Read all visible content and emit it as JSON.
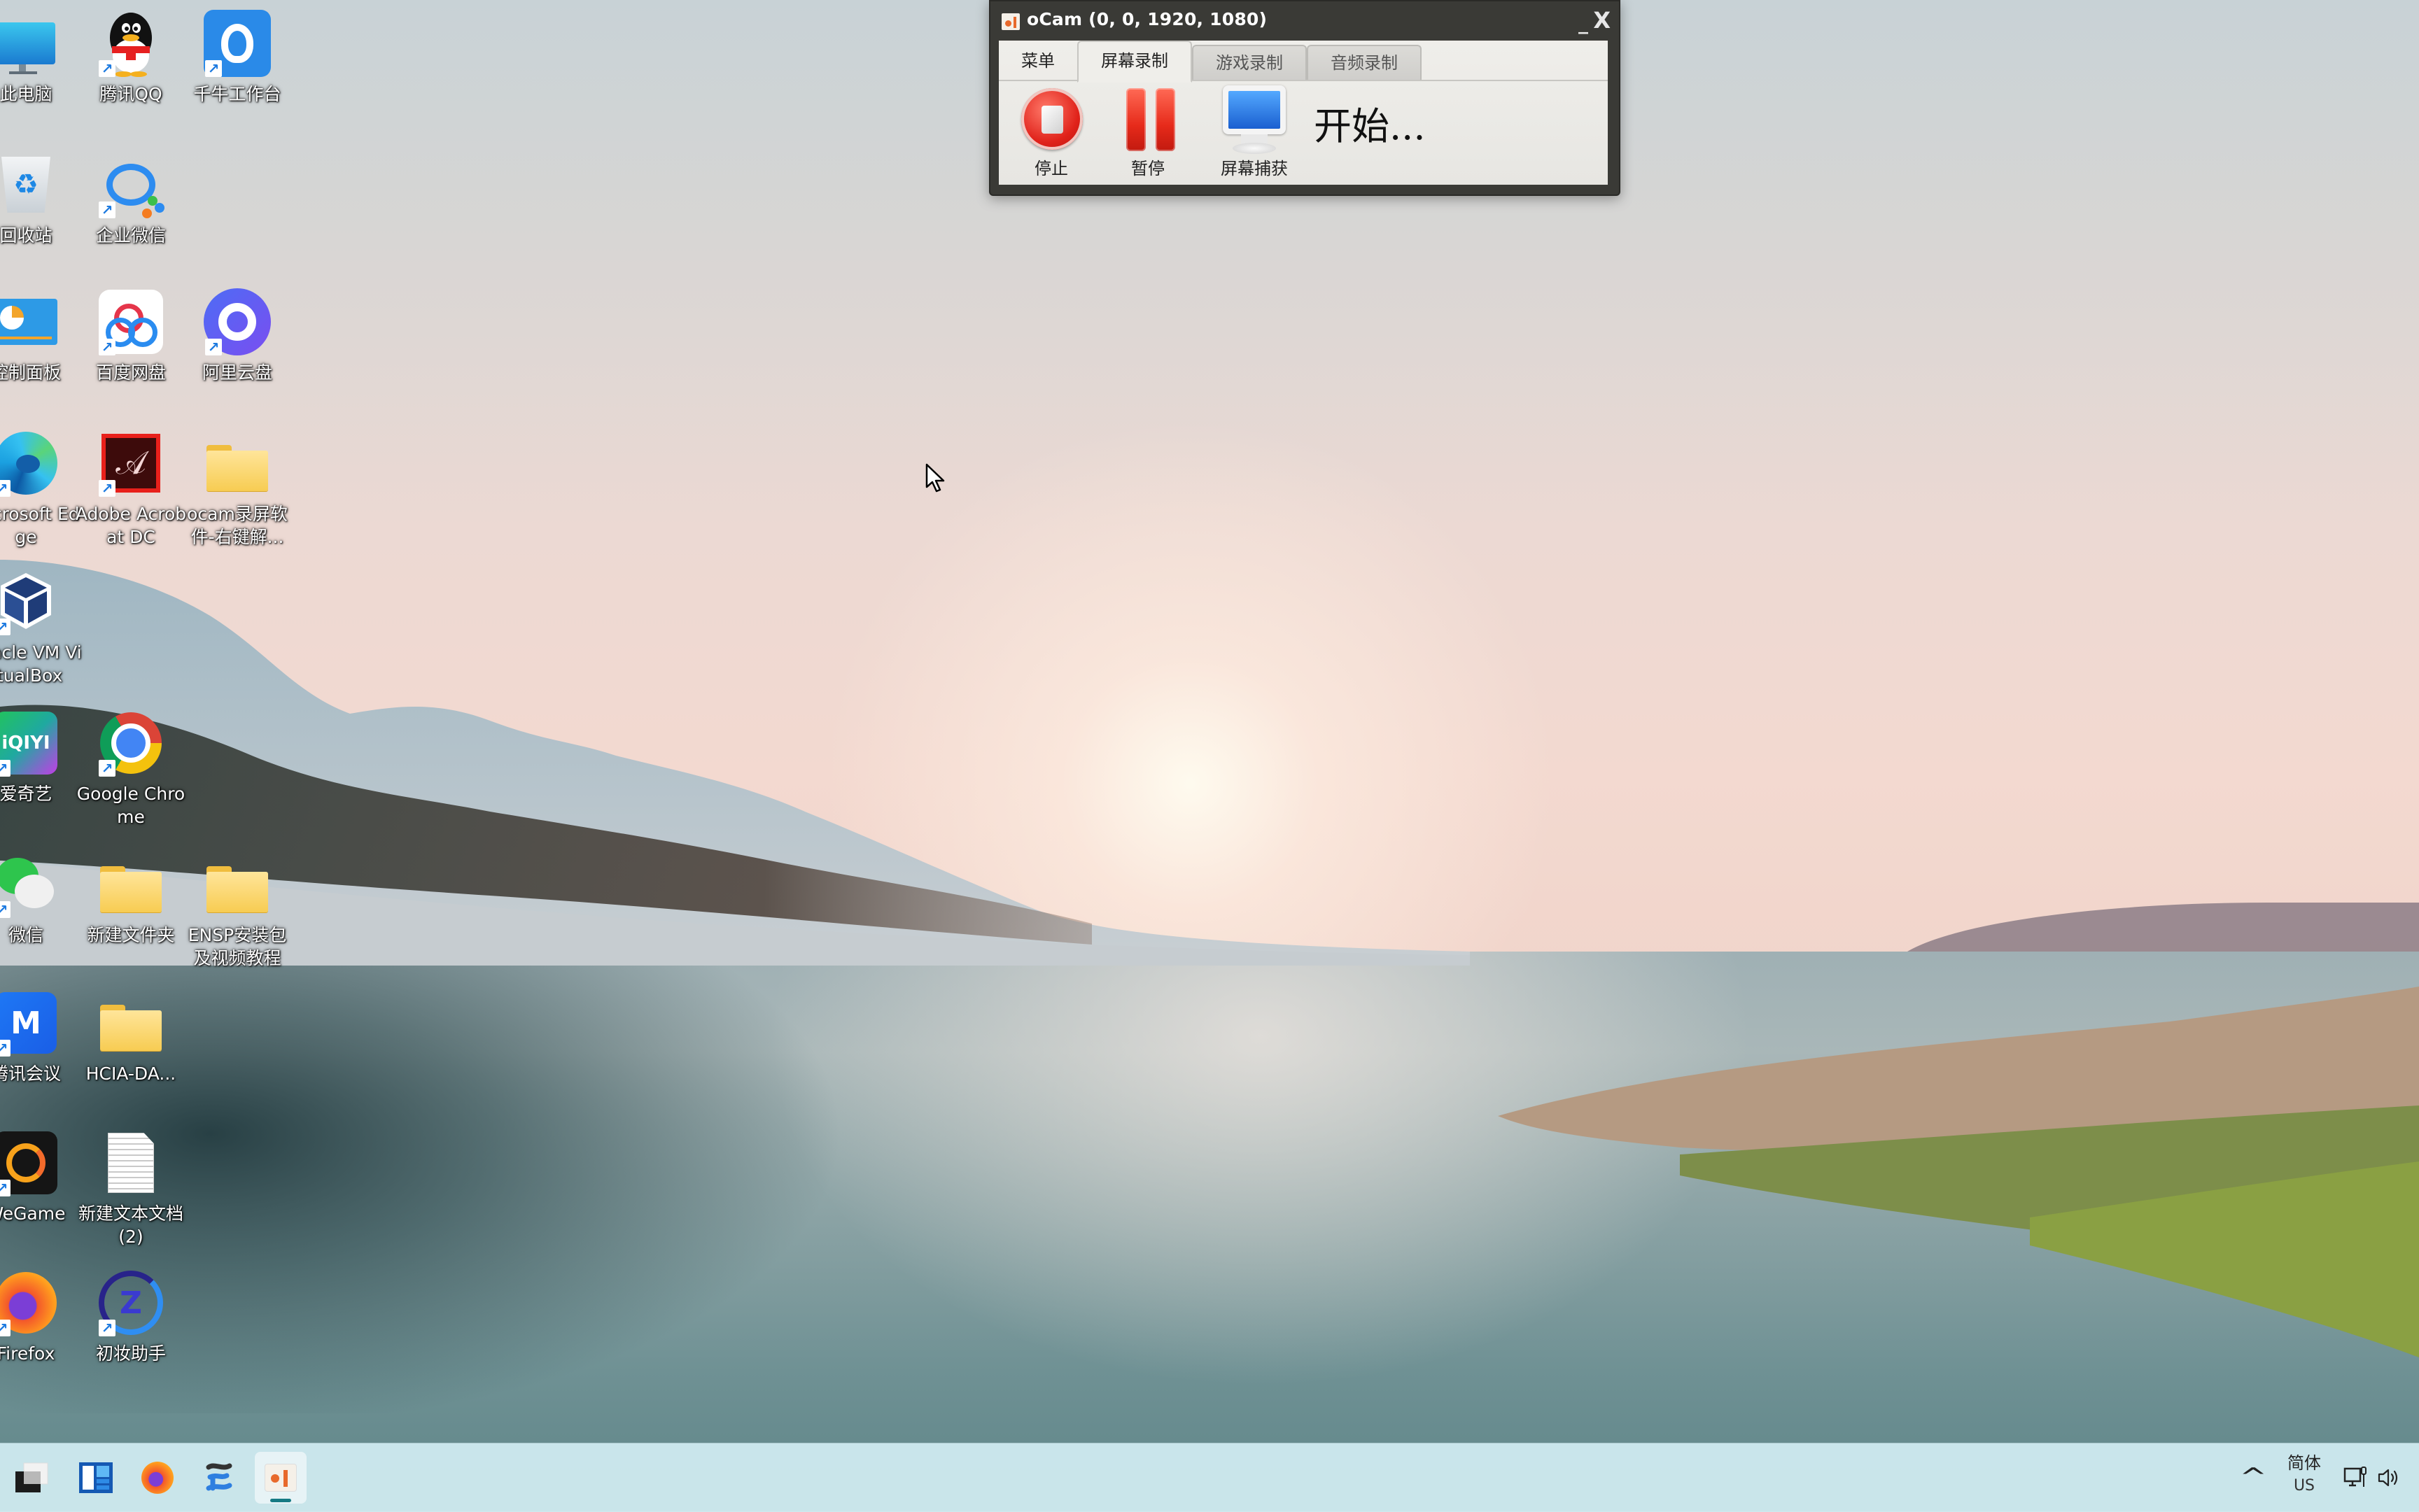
{
  "desktop": {
    "icons": [
      {
        "label": "此电脑",
        "icon": "computer-icon",
        "shortcut": false
      },
      {
        "label": "腾讯QQ",
        "icon": "qq-penguin-icon",
        "shortcut": true
      },
      {
        "label": "千牛工作台",
        "icon": "qianniu-icon",
        "shortcut": true
      },
      {
        "label": "回收站",
        "icon": "recycle-bin-icon",
        "shortcut": false
      },
      {
        "label": "企业微信",
        "icon": "wecom-icon",
        "shortcut": true
      },
      {
        "label": "控制面板",
        "icon": "control-panel-icon",
        "shortcut": false
      },
      {
        "label": "百度网盘",
        "icon": "baidu-netdisk-icon",
        "shortcut": true
      },
      {
        "label": "阿里云盘",
        "icon": "aliyun-drive-icon",
        "shortcut": true
      },
      {
        "label": "Microsoft Edge",
        "icon": "edge-icon",
        "shortcut": true
      },
      {
        "label": "Adobe Acrobat DC",
        "icon": "acrobat-icon",
        "shortcut": true
      },
      {
        "label": "ocam录屏软件-右键解...",
        "icon": "folder-icon",
        "shortcut": false
      },
      {
        "label": "Oracle VM VirtualBox",
        "icon": "virtualbox-icon",
        "shortcut": true
      },
      {
        "label": "爱奇艺",
        "icon": "iqiyi-icon",
        "shortcut": true
      },
      {
        "label": "Google Chrome",
        "icon": "chrome-icon",
        "shortcut": true
      },
      {
        "label": "微信",
        "icon": "wechat-icon",
        "shortcut": true
      },
      {
        "label": "新建文件夹",
        "icon": "folder-icon",
        "shortcut": false
      },
      {
        "label": "ENSP安装包及视频教程",
        "icon": "folder-icon",
        "shortcut": false
      },
      {
        "label": "腾讯会议",
        "icon": "tencent-meeting-icon",
        "shortcut": true
      },
      {
        "label": "HCIA-DA...",
        "icon": "folder-icon",
        "shortcut": false
      },
      {
        "label": "WeGame",
        "icon": "wegame-icon",
        "shortcut": true
      },
      {
        "label": "新建文本文档 (2)",
        "icon": "text-document-icon",
        "shortcut": false
      },
      {
        "label": "Firefox",
        "icon": "firefox-icon",
        "shortcut": true
      },
      {
        "label": "初妆助手",
        "icon": "chuzhuang-icon",
        "shortcut": true
      }
    ]
  },
  "ocam": {
    "title": "oCam (0, 0, 1920, 1080)",
    "minimize_label": "_",
    "close_label": "X",
    "tabs": [
      {
        "label": "菜单",
        "state": "plain"
      },
      {
        "label": "屏幕录制",
        "state": "active"
      },
      {
        "label": "游戏录制",
        "state": "inactive"
      },
      {
        "label": "音频录制",
        "state": "inactive"
      }
    ],
    "toolbar": {
      "stop_label": "停止",
      "pause_label": "暂停",
      "capture_label": "屏幕捕获"
    },
    "status_text": "开始..."
  },
  "taskbar": {
    "apps": [
      {
        "name": "task-view",
        "active": false
      },
      {
        "name": "widgets",
        "active": false
      },
      {
        "name": "firefox",
        "active": false
      },
      {
        "name": "app-blue-links",
        "active": false
      },
      {
        "name": "ocam",
        "active": true
      }
    ],
    "tray": {
      "chevron": "^",
      "ime_line1": "简体",
      "ime_line2": "US"
    }
  },
  "colors": {
    "ocam_frame": "#3a3a36",
    "ocam_client": "#efeeea",
    "record_red": "#e0221a",
    "taskbar_bg": "#cde9ee",
    "taskbar_indicator": "#157a84"
  }
}
